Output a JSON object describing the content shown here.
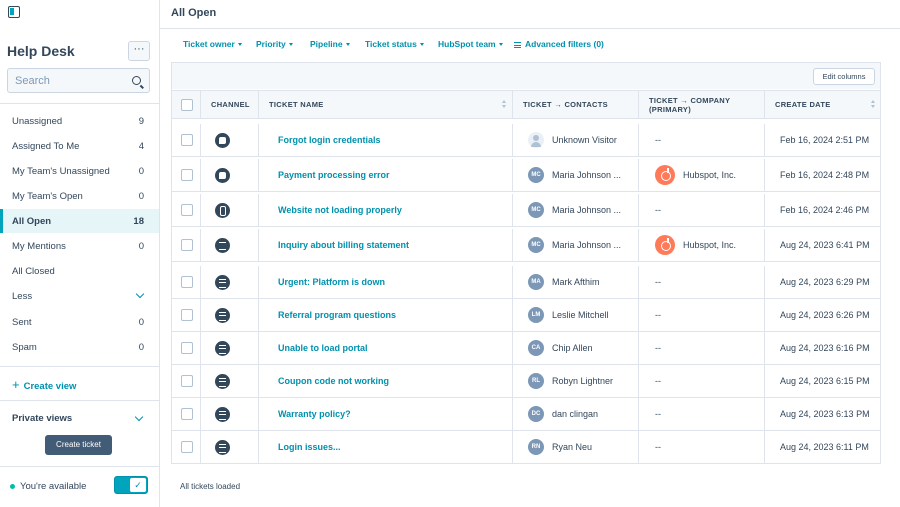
{
  "sidebar": {
    "title": "Help Desk",
    "more_label": "···",
    "search_placeholder": "Search",
    "items": [
      {
        "label": "Unassigned",
        "count": "9"
      },
      {
        "label": "Assigned To Me",
        "count": "4"
      },
      {
        "label": "My Team's Unassigned",
        "count": "0"
      },
      {
        "label": "My Team's Open",
        "count": "0"
      },
      {
        "label": "All Open",
        "count": "18",
        "active": true
      },
      {
        "label": "My Mentions",
        "count": "0"
      },
      {
        "label": "All Closed",
        "count": ""
      },
      {
        "label": "Less",
        "count": ""
      },
      {
        "label": "Sent",
        "count": "0"
      },
      {
        "label": "Spam",
        "count": "0"
      }
    ],
    "create_view": "Create view",
    "private_views": "Private views",
    "create_ticket": "Create ticket",
    "availability": "You're available"
  },
  "header": {
    "title": "All Open"
  },
  "filters": [
    "Ticket owner",
    "Priority",
    "Pipeline",
    "Ticket status",
    "HubSpot team"
  ],
  "advanced_filters": "Advanced filters (0)",
  "table": {
    "edit_columns": "Edit columns",
    "columns": {
      "channel": "CHANNEL",
      "ticket_name": "TICKET NAME",
      "contacts": "TICKET → CONTACTS",
      "company_line1": "TICKET → COMPANY",
      "company_line2": "(PRIMARY)",
      "create_date": "CREATE DATE"
    },
    "rows": [
      {
        "channel": "chat-icon",
        "name": "Forgot login credentials",
        "initials": "",
        "contact": "Unknown Visitor",
        "company": "--",
        "date": "Feb 16, 2024 2:51 PM"
      },
      {
        "channel": "chat-icon",
        "name": "Payment processing error",
        "initials": "MC",
        "contact": "Maria Johnson ...",
        "company": "Hubspot, Inc.",
        "date": "Feb 16, 2024 2:48 PM"
      },
      {
        "channel": "phone-icon",
        "name": "Website not loading properly",
        "initials": "MC",
        "contact": "Maria Johnson ...",
        "company": "--",
        "date": "Feb 16, 2024 2:46 PM"
      },
      {
        "channel": "email-icon",
        "name": "Inquiry about billing statement",
        "initials": "MC",
        "contact": "Maria Johnson ...",
        "company": "Hubspot, Inc.",
        "date": "Aug 24, 2023 6:41 PM"
      },
      {
        "channel": "form-icon",
        "name": "Urgent: Platform is down",
        "initials": "MA",
        "contact": "Mark Afthim",
        "company": "--",
        "date": "Aug 24, 2023 6:29 PM"
      },
      {
        "channel": "form-icon",
        "name": "Referral program questions",
        "initials": "LM",
        "contact": "Leslie Mitchell",
        "company": "--",
        "date": "Aug 24, 2023 6:26 PM"
      },
      {
        "channel": "form-icon",
        "name": "Unable to load portal",
        "initials": "CA",
        "contact": "Chip Allen",
        "company": "--",
        "date": "Aug 24, 2023 6:16 PM"
      },
      {
        "channel": "form-icon",
        "name": "Coupon code not working",
        "initials": "RL",
        "contact": "Robyn Lightner",
        "company": "--",
        "date": "Aug 24, 2023 6:15 PM"
      },
      {
        "channel": "form-icon",
        "name": "Warranty policy?",
        "initials": "DC",
        "contact": "dan clingan",
        "company": "--",
        "date": "Aug 24, 2023 6:13 PM"
      },
      {
        "channel": "form-icon",
        "name": "Login issues...",
        "initials": "RN",
        "contact": "Ryan Neu",
        "company": "--",
        "date": "Aug 24, 2023 6:11 PM"
      }
    ],
    "status": "All tickets loaded"
  },
  "colors": {
    "accent": "#00a4bd",
    "link": "#0091ae",
    "text": "#33475b",
    "hubspot_orange": "#ff7a59",
    "button_dark": "#425b76"
  }
}
